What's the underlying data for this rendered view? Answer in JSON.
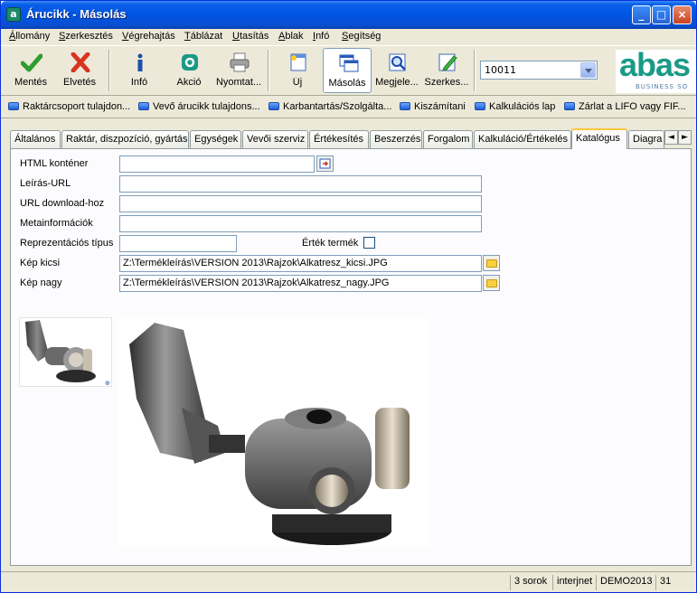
{
  "window": {
    "title": "Árucikk - Másolás"
  },
  "menu": [
    "Állomány",
    "Szerkesztés",
    "Végrehajtás",
    "Táblázat",
    "Utasítás",
    "Ablak",
    "Infó",
    "Segítség"
  ],
  "toolbar": {
    "buttons": [
      "Mentés",
      "Elvetés",
      "Infó",
      "Akció",
      "Nyomtat...",
      "Új",
      "Másolás",
      "Megjele...",
      "Szerkes..."
    ],
    "combo_value": "10011"
  },
  "logo": {
    "word": "abas",
    "subtitle": "BUSINESS SO"
  },
  "quicklinks": [
    "Raktárcsoport tulajdon...",
    "Vevő árucikk tulajdons...",
    "Karbantartás/Szolgálta...",
    "Kiszámítani",
    "Kalkulációs lap",
    "Zárlat a LIFO vagy FIF..."
  ],
  "tabs": [
    "Általános",
    "Raktár, diszpozíció, gyártás",
    "Egységek",
    "Vevői szerviz",
    "Értékesítés",
    "Beszerzés",
    "Forgalom",
    "Kalkuláció/Értékelés",
    "Katalógus",
    "Diagra"
  ],
  "active_tab": "Katalógus",
  "form": {
    "html_container_label": "HTML konténer",
    "html_container_value": "",
    "desc_url_label": "Leírás-URL",
    "desc_url_value": "",
    "download_url_label": "URL download-hoz",
    "download_url_value": "",
    "meta_label": "Metainformációk",
    "meta_value": "",
    "repr_label": "Reprezentációs típus",
    "repr_value": "",
    "value_product_label": "Érték termék",
    "value_product_checked": false,
    "img_small_label": "Kép kicsi",
    "img_small_value": "Z:\\Termékleírás\\VERSION 2013\\Rajzok\\Alkatresz_kicsi.JPG",
    "img_large_label": "Kép nagy",
    "img_large_value": "Z:\\Termékleírás\\VERSION 2013\\Rajzok\\Alkatresz_nagy.JPG"
  },
  "status": [
    "3 sorok",
    "interjnet",
    "DEMO2013",
    "31"
  ]
}
